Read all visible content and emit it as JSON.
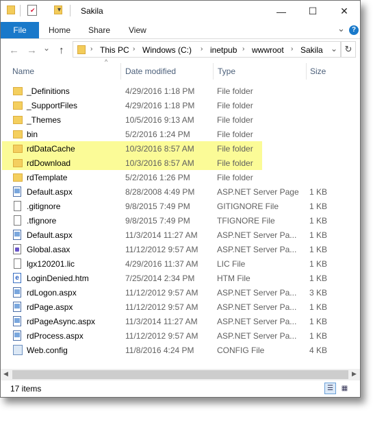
{
  "window": {
    "title": "Sakila",
    "minimize_glyph": "—",
    "maximize_glyph": "☐",
    "close_glyph": "✕"
  },
  "ribbon": {
    "tabs": [
      "File",
      "Home",
      "Share",
      "View"
    ],
    "expand_glyph": "⌄",
    "help_glyph": "?"
  },
  "address": {
    "back_glyph": "←",
    "forward_glyph": "→",
    "recent_glyph": "⌄",
    "up_glyph": "↑",
    "breadcrumb": [
      "This PC",
      "Windows (C:)",
      "inetpub",
      "wwwroot",
      "Sakila"
    ],
    "separator_glyph": "›",
    "dropdown_glyph": "⌄",
    "refresh_glyph": "↻"
  },
  "columns": {
    "name": "Name",
    "date": "Date modified",
    "type": "Type",
    "size": "Size",
    "sort_glyph": "^"
  },
  "files": [
    {
      "name": "_Definitions",
      "date": "4/29/2016 1:18 PM",
      "type": "File folder",
      "size": "",
      "icon": "folder-icon",
      "highlight": false
    },
    {
      "name": "_SupportFiles",
      "date": "4/29/2016 1:18 PM",
      "type": "File folder",
      "size": "",
      "icon": "folder-icon",
      "highlight": false
    },
    {
      "name": "_Themes",
      "date": "10/5/2016 9:13 AM",
      "type": "File folder",
      "size": "",
      "icon": "folder-icon",
      "highlight": false
    },
    {
      "name": "bin",
      "date": "5/2/2016 1:24 PM",
      "type": "File folder",
      "size": "",
      "icon": "folder-icon",
      "highlight": false
    },
    {
      "name": "rdDataCache",
      "date": "10/3/2016 8:57 AM",
      "type": "File folder",
      "size": "",
      "icon": "folder-icon",
      "highlight": true
    },
    {
      "name": "rdDownload",
      "date": "10/3/2016 8:57 AM",
      "type": "File folder",
      "size": "",
      "icon": "folder-icon",
      "highlight": true
    },
    {
      "name": "rdTemplate",
      "date": "5/2/2016 1:26 PM",
      "type": "File folder",
      "size": "",
      "icon": "folder-icon",
      "highlight": false
    },
    {
      "name": "Default.aspx",
      "date": "8/28/2008 4:49 PM",
      "type": "ASP.NET Server Page",
      "size": "1 KB",
      "icon": "aspx-file-icon",
      "highlight": false
    },
    {
      "name": ".gitignore",
      "date": "9/8/2015 7:49 PM",
      "type": "GITIGNORE File",
      "size": "1 KB",
      "icon": "blank-file-icon",
      "highlight": false
    },
    {
      "name": ".tfignore",
      "date": "9/8/2015 7:49 PM",
      "type": "TFIGNORE File",
      "size": "1 KB",
      "icon": "blank-file-icon",
      "highlight": false
    },
    {
      "name": "Default.aspx",
      "date": "11/3/2014 11:27 AM",
      "type": "ASP.NET Server Pa...",
      "size": "1 KB",
      "icon": "aspx-file-icon",
      "highlight": false
    },
    {
      "name": "Global.asax",
      "date": "11/12/2012 9:57 AM",
      "type": "ASP.NET Server Pa...",
      "size": "1 KB",
      "icon": "asax-file-icon",
      "highlight": false
    },
    {
      "name": "lgx120201.lic",
      "date": "4/29/2016 11:37 AM",
      "type": "LIC File",
      "size": "1 KB",
      "icon": "blank-file-icon",
      "highlight": false
    },
    {
      "name": "LoginDenied.htm",
      "date": "7/25/2014 2:34 PM",
      "type": "HTM File",
      "size": "1 KB",
      "icon": "htm-file-icon",
      "highlight": false
    },
    {
      "name": "rdLogon.aspx",
      "date": "11/12/2012 9:57 AM",
      "type": "ASP.NET Server Pa...",
      "size": "3 KB",
      "icon": "aspx-file-icon",
      "highlight": false
    },
    {
      "name": "rdPage.aspx",
      "date": "11/12/2012 9:57 AM",
      "type": "ASP.NET Server Pa...",
      "size": "1 KB",
      "icon": "aspx-file-icon",
      "highlight": false
    },
    {
      "name": "rdPageAsync.aspx",
      "date": "11/3/2014 11:27 AM",
      "type": "ASP.NET Server Pa...",
      "size": "1 KB",
      "icon": "aspx-file-icon",
      "highlight": false
    },
    {
      "name": "rdProcess.aspx",
      "date": "11/12/2012 9:57 AM",
      "type": "ASP.NET Server Pa...",
      "size": "1 KB",
      "icon": "aspx-file-icon",
      "highlight": false
    },
    {
      "name": "Web.config",
      "date": "11/8/2016 4:24 PM",
      "type": "CONFIG File",
      "size": "4 KB",
      "icon": "config-file-icon",
      "highlight": false
    }
  ],
  "scrollbar": {
    "left_glyph": "◀",
    "right_glyph": "▶"
  },
  "status": {
    "item_count": "17 items",
    "details_view_glyph": "☰",
    "icons_view_glyph": "▦"
  },
  "colors": {
    "file_tab": "#1979ca",
    "highlight": "#fbfb97",
    "folder": "#f4cf5f"
  }
}
